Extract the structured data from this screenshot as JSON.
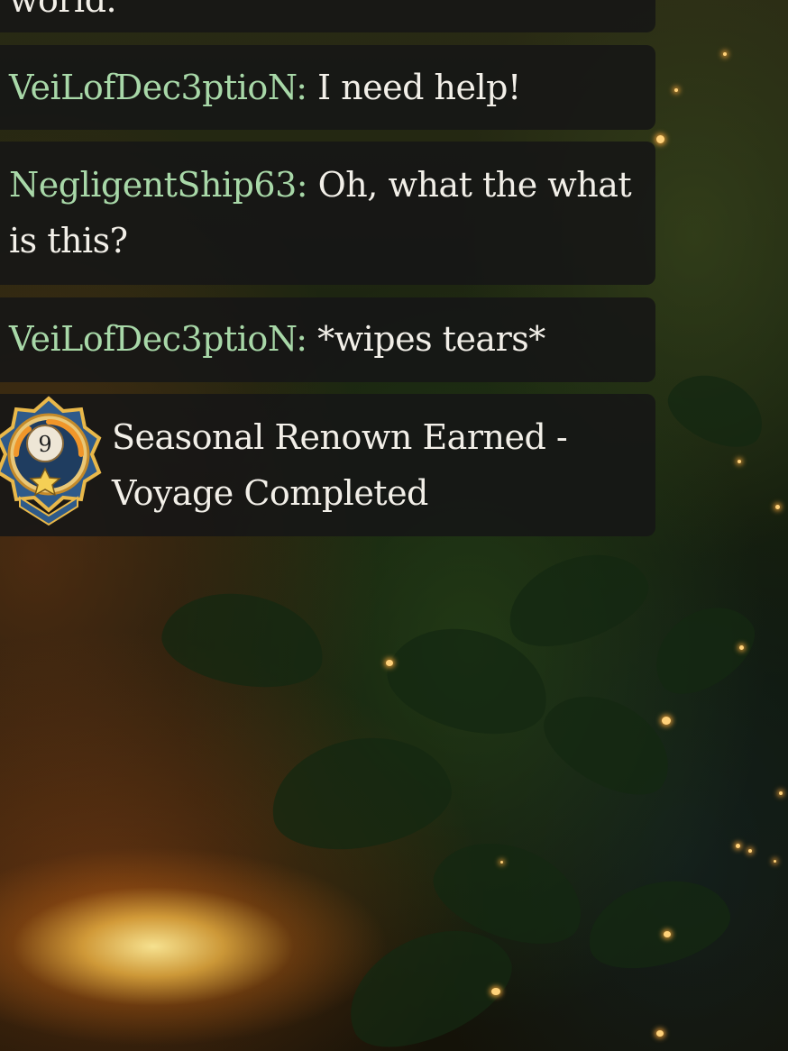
{
  "chat": {
    "partial_top_text": "world.",
    "messages": [
      {
        "user": "VeiLofDec3ptioN:",
        "text": " I need help!"
      },
      {
        "user": "NegligentShip63:",
        "text": " Oh, what the what is this?"
      },
      {
        "user": "VeiLofDec3ptioN:",
        "text": " *wipes tears*"
      }
    ]
  },
  "notification": {
    "badge_number": "9",
    "text": "Seasonal Renown Earned - Voyage Completed"
  },
  "colors": {
    "username": "#a8d8a8",
    "message_text": "#f2efe8",
    "panel_bg": "rgba(22,22,22,0.88)",
    "badge_gold": "#e9b84a",
    "badge_blue": "#2e5a8a",
    "badge_orange": "#f0962a"
  }
}
